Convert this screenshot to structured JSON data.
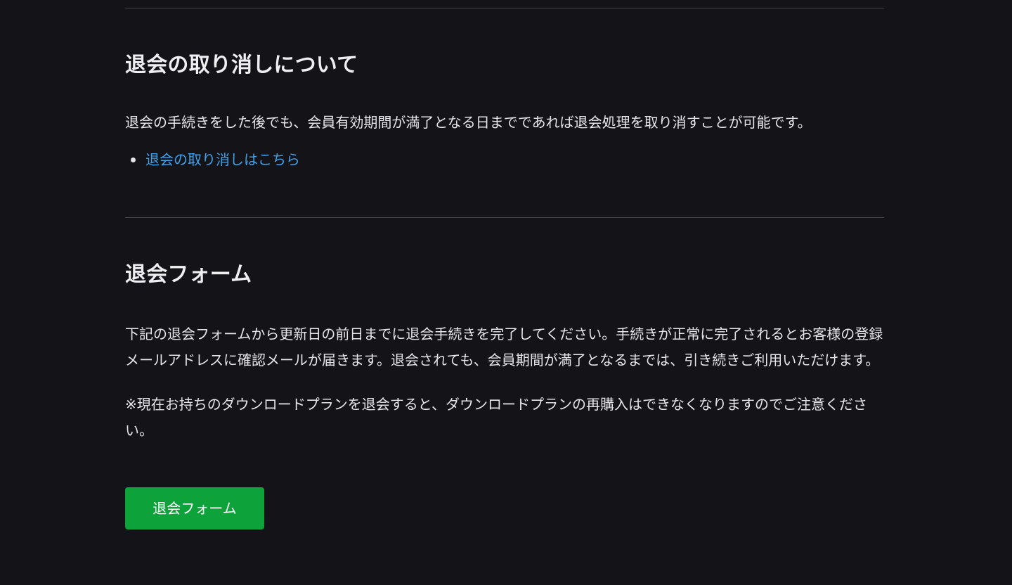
{
  "cancel_section": {
    "title": "退会の取り消しについて",
    "description": "退会の手続きをした後でも、会員有効期間が満了となる日までであれば退会処理を取り消すことが可能です。",
    "link_label": "退会の取り消しはこちら"
  },
  "form_section": {
    "title": "退会フォーム",
    "description": "下記の退会フォームから更新日の前日までに退会手続きを完了してください。手続きが正常に完了されるとお客様の登録メールアドレスに確認メールが届きます。退会されても、会員期間が満了となるまでは、引き続きご利用いただけます。",
    "note": "※現在お持ちのダウンロードプランを退会すると、ダウンロードプランの再購入はできなくなりますのでご注意ください。",
    "button_label": "退会フォーム"
  },
  "colors": {
    "background": "#141318",
    "link": "#3fa2ec",
    "button": "#0ea33a",
    "divider": "#4a4a50"
  }
}
